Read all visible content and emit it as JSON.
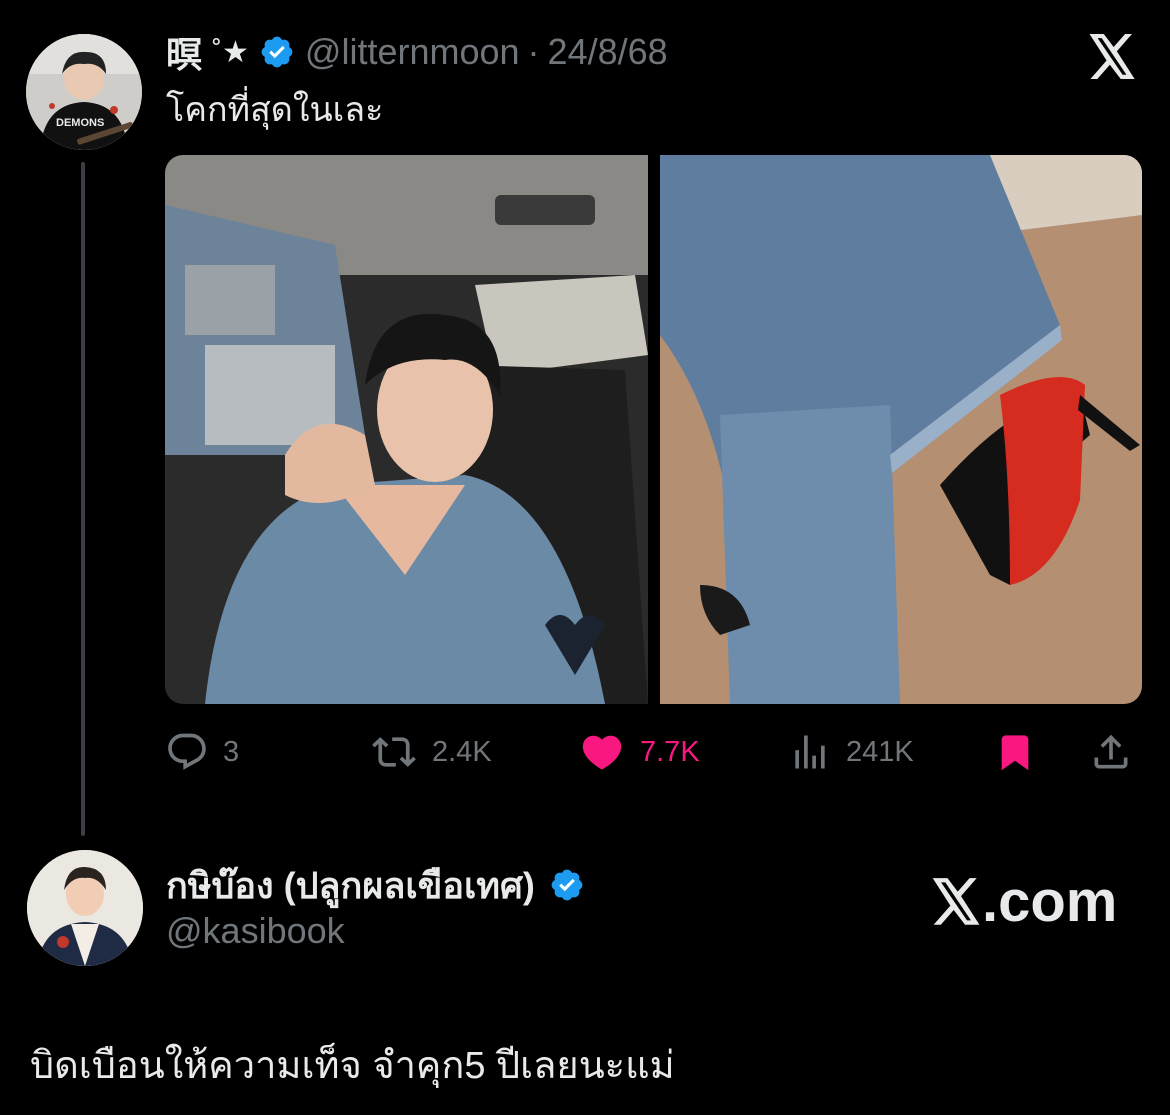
{
  "tweet": {
    "display_name": "暝",
    "name_symbol": "˚★",
    "handle": "@litternmoon",
    "separator": "·",
    "date": "24/8/68",
    "text": "โคกที่สุดในเละ",
    "avatar_shirt_text": "DEMONS",
    "actions": {
      "replies": "3",
      "reposts": "2.4K",
      "likes": "7.7K",
      "views": "241K"
    },
    "like_color": "#f91880",
    "verified_color": "#1d9bf0"
  },
  "quote": {
    "display_name": "กษิบ๊อง (ปลูกผลเขือเทศ)",
    "handle": "@kasibook",
    "source": ".com",
    "text": "บิดเบือนให้ความเท็จ จำคุก5 ปีเลยนะแม่"
  },
  "icons": [
    "x-logo-icon",
    "verified-badge-icon",
    "reply-icon",
    "repost-icon",
    "like-icon",
    "views-icon",
    "bookmark-icon",
    "share-icon"
  ]
}
